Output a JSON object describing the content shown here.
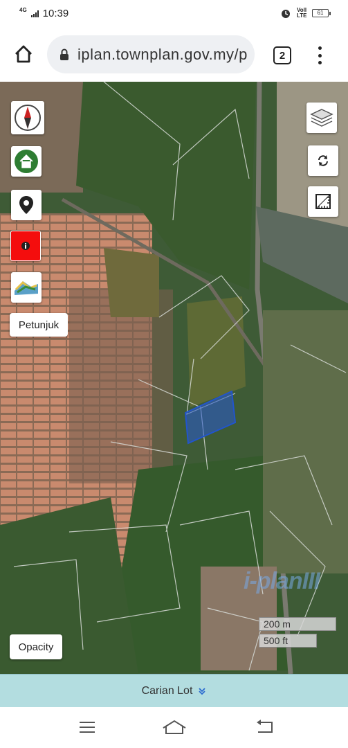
{
  "status_bar": {
    "network": "4G",
    "time": "10:39",
    "volte": "Voll LTE",
    "battery": "61"
  },
  "browser": {
    "url": "iplan.townplan.gov.my/p",
    "tab_count": "2"
  },
  "map": {
    "controls": [
      {
        "name": "compass-icon"
      },
      {
        "name": "home-icon"
      },
      {
        "name": "location-pin-icon"
      },
      {
        "name": "info-icon"
      },
      {
        "name": "terrain-layer-icon"
      }
    ],
    "petunjuk_label": "Petunjuk",
    "opacity_label": "Opacity",
    "scale_metric": "200 m",
    "scale_imperial": "500 ft",
    "watermark": "i-planIII",
    "right_controls": [
      {
        "name": "layers-icon"
      },
      {
        "name": "refresh-icon"
      },
      {
        "name": "measure-icon"
      }
    ]
  },
  "search": {
    "label": "Carian Lot",
    "chevron": "⌄⌄"
  },
  "colors": {
    "search_bar": "#b3dde0",
    "info_button": "#f40d0d",
    "polygon": "#2255cc"
  }
}
